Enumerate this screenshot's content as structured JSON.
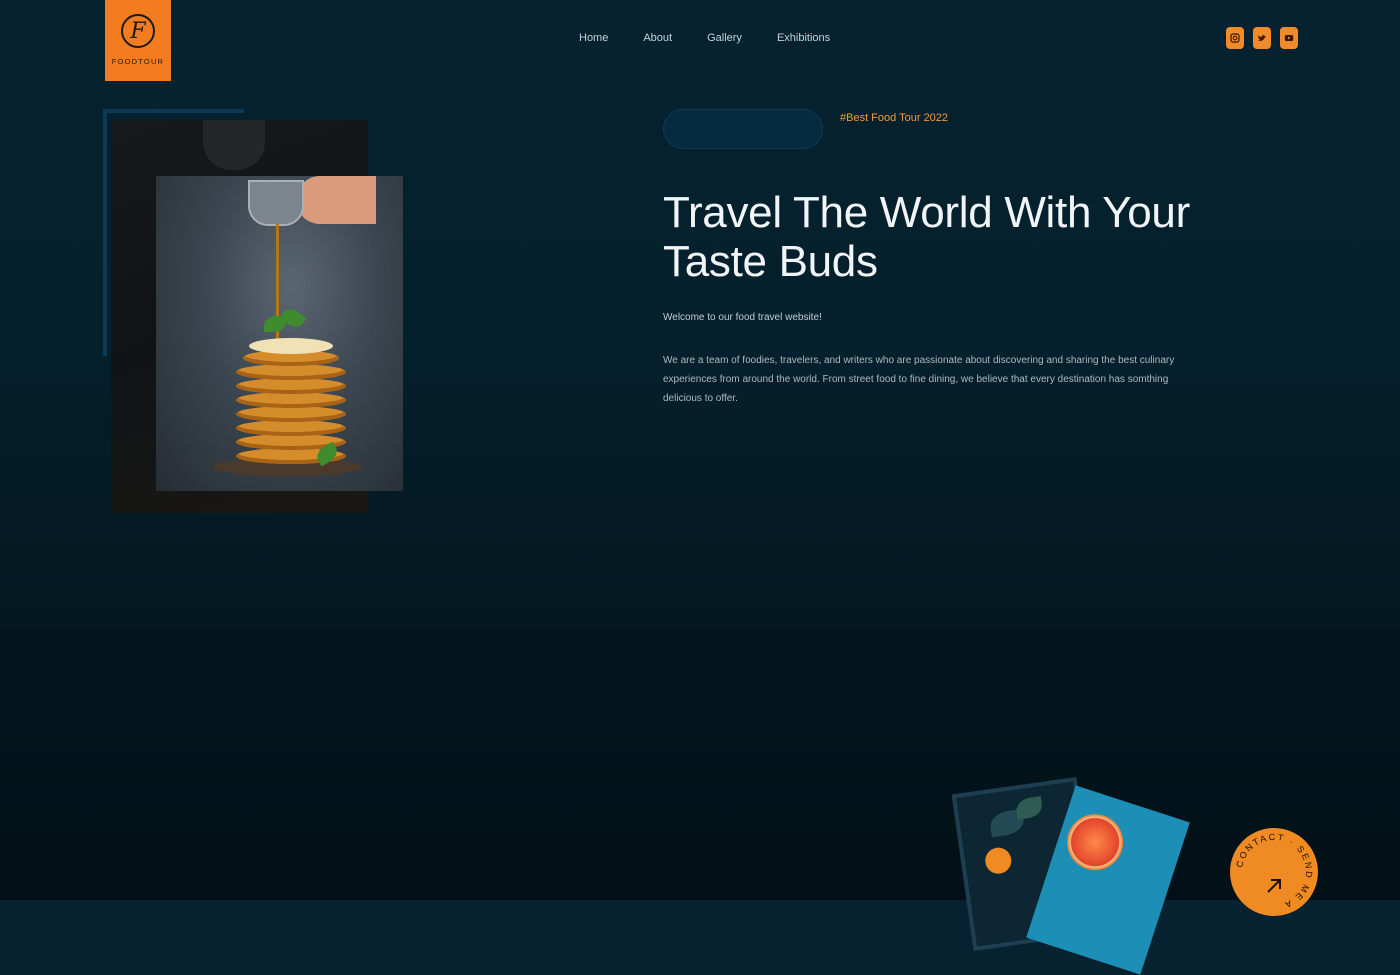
{
  "brand": {
    "logo_letter": "F",
    "logo_text": "FOODTOUR",
    "color": "#f47c20"
  },
  "nav": {
    "items": [
      "Home",
      "About",
      "Gallery",
      "Exhibitions"
    ]
  },
  "social": [
    {
      "name": "instagram-icon"
    },
    {
      "name": "twitter-icon"
    },
    {
      "name": "youtube-icon"
    }
  ],
  "hero": {
    "tag": "#Best Food Tour 2022",
    "headline": "Travel The World With Your Taste Buds",
    "welcome": "Welcome to our food travel website!",
    "description": "We are a team of foodies, travelers, and writers who are passionate about discovering and sharing the best culinary experiences from around the world. From street food to fine dining, we believe that every destination has somthing delicious to offer."
  },
  "contact_badge": {
    "text": "CONTACT · SEND ME A"
  },
  "colors": {
    "accent": "#f08a22",
    "background": "#04202c"
  }
}
